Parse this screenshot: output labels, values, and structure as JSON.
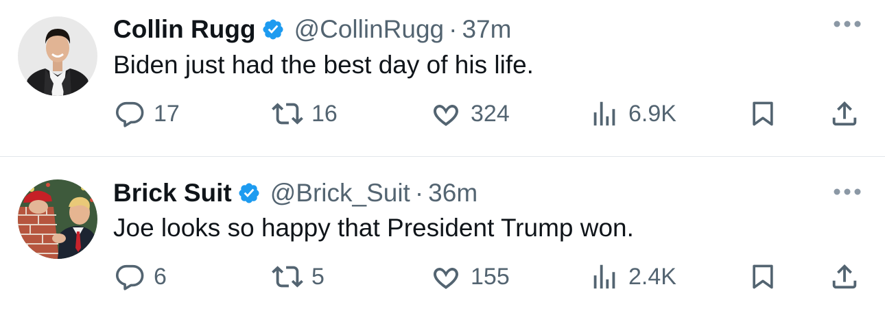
{
  "tweets": [
    {
      "name": "Collin Rugg",
      "handle": "@CollinRugg",
      "separator": "·",
      "time": "37m",
      "text": "Biden just had the best day of his life.",
      "replies": "17",
      "retweets": "16",
      "likes": "324",
      "views": "6.9K"
    },
    {
      "name": "Brick Suit",
      "handle": "@Brick_Suit",
      "separator": "·",
      "time": "36m",
      "text": "Joe looks so happy that President Trump won.",
      "replies": "6",
      "retweets": "5",
      "likes": "155",
      "views": "2.4K"
    }
  ],
  "colors": {
    "primary_text": "#0f1419",
    "secondary_text": "#536471",
    "verified_badge": "#1d9bf0",
    "divider": "#e1e6ea"
  },
  "icons": [
    "verified-badge-icon",
    "more-icon",
    "reply-icon",
    "retweet-icon",
    "like-icon",
    "views-icon",
    "bookmark-icon",
    "share-icon"
  ]
}
